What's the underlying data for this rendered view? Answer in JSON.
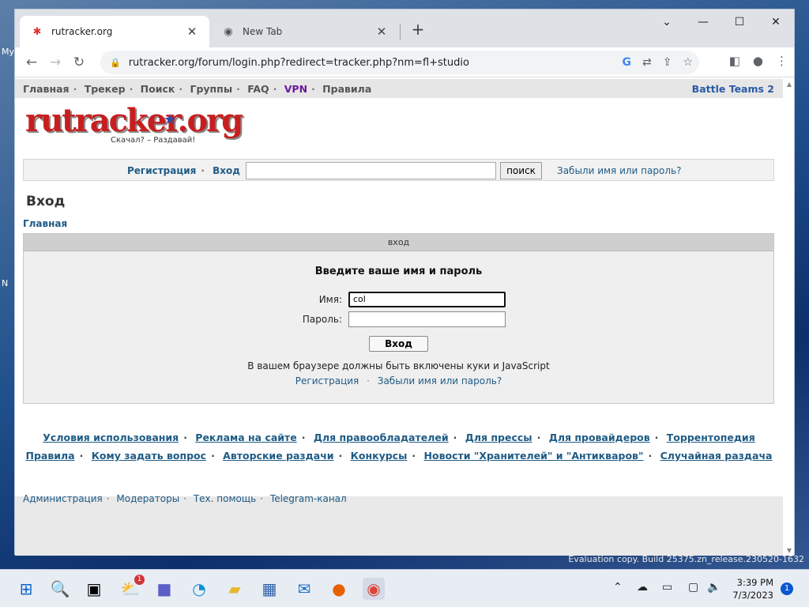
{
  "desktop": {
    "labels": [
      "My",
      "N"
    ]
  },
  "browser": {
    "tabs": [
      {
        "title": "rutracker.org",
        "active": true
      },
      {
        "title": "New Tab",
        "active": false
      }
    ],
    "url": "rutracker.org/forum/login.php?redirect=tracker.php?nm=fl+studio"
  },
  "site": {
    "nav": [
      "Главная",
      "Трекер",
      "Поиск",
      "Группы",
      "FAQ",
      "VPN",
      "Правила"
    ],
    "battle_teams": "Battle Teams 2",
    "logo_text": "rutracker.org",
    "slogan": "Скачал? – Раздавай!",
    "search": {
      "register": "Регистрация",
      "login": "Вход",
      "button": "поиск",
      "forgot": "Забыли имя или пароль?"
    },
    "page_title": "Вход",
    "breadcrumb": "Главная",
    "login_box": {
      "header": "вход",
      "prompt": "Введите ваше имя и пароль",
      "name_label": "Имя:",
      "name_value": "col",
      "password_label": "Пароль:",
      "password_value": "",
      "submit": "Вход",
      "note": "В вашем браузере должны быть включены куки и JavaScript",
      "register": "Регистрация",
      "forgot": "Забыли имя или пароль?"
    },
    "footer_row1": [
      "Условия использования",
      "Реклама на сайте",
      "Для правообладателей",
      "Для прессы",
      "Для провайдеров",
      "Торрентопедия"
    ],
    "footer_row2": [
      "Правила",
      "Кому задать вопрос",
      "Авторские раздачи",
      "Конкурсы",
      "Новости \"Хранителей\" и \"Антикваров\"",
      "Случайная раздача"
    ],
    "footer_row3": [
      "Администрация",
      "Модераторы",
      "Тех. помощь",
      "Telegram-канал"
    ]
  },
  "os": {
    "watermark": "Evaluation copy. Build 25375.zn_release.230520-1632",
    "time": "3:39 PM",
    "date": "7/3/2023",
    "notifications": "1",
    "mail_badge": "1"
  }
}
